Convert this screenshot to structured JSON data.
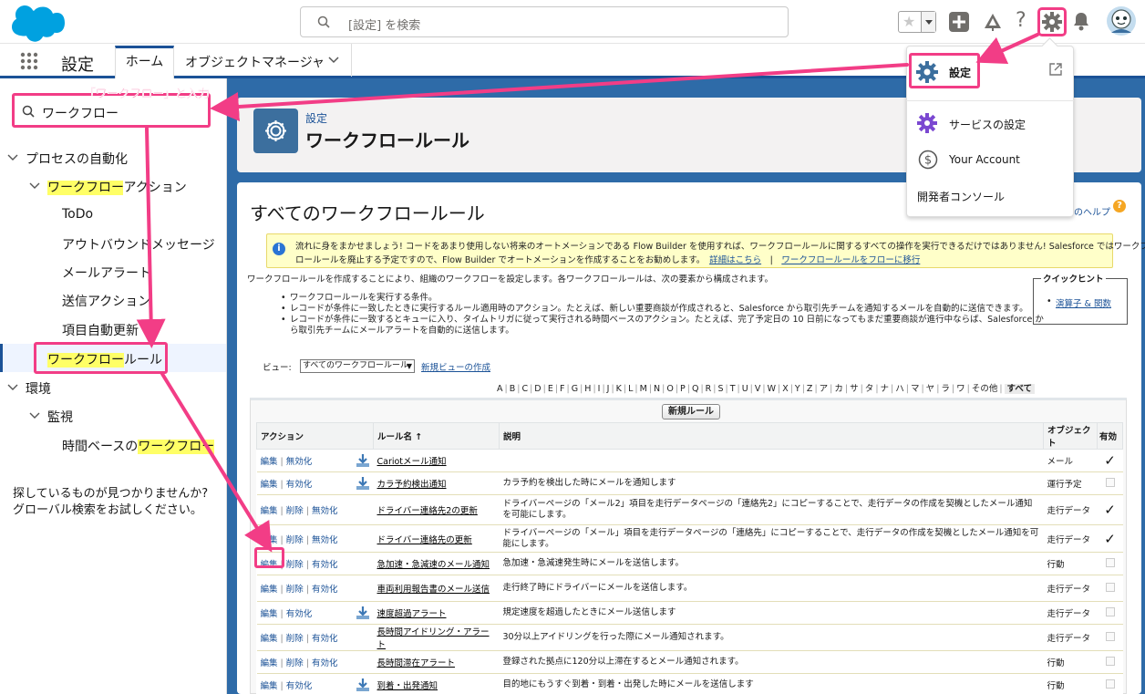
{
  "header": {
    "search_placeholder": "[設定] を検索",
    "colors": {
      "brand": "#00a1e0",
      "accent": "#1b5297",
      "highlight": "#f23d86"
    }
  },
  "nav": {
    "app_title": "設定",
    "tabs": [
      {
        "label": "ホーム"
      },
      {
        "label": "オブジェクトマネージャ"
      }
    ]
  },
  "annotation": {
    "sidebar_label": "「ワークフロー」と入力"
  },
  "sidebar": {
    "search_value": "ワークフロー",
    "process_automation": "プロセスの自動化",
    "workflow_actions_hl": "ワークフロー",
    "workflow_actions_rest": "アクション",
    "items": [
      "ToDo",
      "アウトバウンドメッセージ",
      "メールアラート",
      "送信アクション",
      "項目自動更新"
    ],
    "workflow_rules_hl": "ワークフロー",
    "workflow_rules_rest": "ルール",
    "environment": "環境",
    "monitoring": "監視",
    "time_based_prefix": "時間ベースの",
    "time_based_hl": "ワークフロー",
    "not_found_1": "探しているものが見つかりませんか?",
    "not_found_2": "グローバル検索をお試しください。"
  },
  "page_header": {
    "breadcrumb": "設定",
    "title": "ワークフロールール"
  },
  "main": {
    "title": "すべてのワークフロールール",
    "help_link": "のヘルプ",
    "info_line1": "流れに身をまかせましょう! コードをあまり使用しない将来のオートメーションである Flow Builder を使用すれば、ワークフロールールに関するすべての操作を実行できるだけではありません! Salesforce ではワークフ",
    "info_line2": "ロールールを廃止する予定ですので、Flow Builder でオートメーションを作成することをお勧めします。",
    "info_link1": "詳細はこちら",
    "info_sep": "|",
    "info_link2": "ワークフロールールをフローに移行",
    "description": "ワークフロールールを作成することにより、組織のワークフローを設定します。各ワークフロールールは、次の要素から構成されます。",
    "bullets": [
      "ワークフロールールを実行する条件。",
      "レコードが条件に一致したときに実行するルール適用時のアクション。たとえば、新しい重要商談が作成されると、Salesforce から取引先チームを通知するメールを自動的に送信できます。",
      "レコードが条件に一致するとキューに入り、タイムトリガに従って実行される時間ベースのアクション。たとえば、完了予定日の 10 日前になってもまだ重要商談が進行中ならば、Salesforce か",
      "ら取引先チームにメールアラートを自動的に送信します。"
    ],
    "tips_title": "クイックヒント",
    "tips_link": "演算子 & 関数",
    "view_label": "ビュー:",
    "view_selected": "すべてのワークフロールール",
    "new_view": "新規ビューの作成",
    "alphabet": [
      "A",
      "B",
      "C",
      "D",
      "E",
      "F",
      "G",
      "H",
      "I",
      "J",
      "K",
      "L",
      "M",
      "N",
      "O",
      "P",
      "Q",
      "R",
      "S",
      "T",
      "U",
      "V",
      "W",
      "X",
      "Y",
      "Z",
      "ア",
      "カ",
      "サ",
      "タ",
      "ナ",
      "ハ",
      "マ",
      "ヤ",
      "ラ",
      "ワ",
      "その他",
      "すべて"
    ],
    "new_rule_button": "新規ルール"
  },
  "table": {
    "headers": [
      "アクション",
      "ルール名 ↑",
      "説明",
      "オブジェクト",
      "有効"
    ],
    "rows": [
      {
        "actions": [
          "編集",
          "無効化"
        ],
        "name": "Cariotメール通知",
        "desc": "",
        "object": "メール",
        "active": "✓"
      },
      {
        "actions": [
          "編集",
          "有効化"
        ],
        "name": "カラ予約検出通知",
        "desc": "カラ予約を検出した時にメールを通知します",
        "object": "運行予定",
        "active": ""
      },
      {
        "actions": [
          "編集",
          "削除",
          "無効化"
        ],
        "name": "ドライバー連絡先2の更新",
        "desc": "ドライバーページの「メール2」項目を走行データページの「連絡先2」にコピーすることで、走行データの作成を契機としたメール通知を可能にします。",
        "object": "走行データ",
        "active": "✓"
      },
      {
        "actions": [
          "編集",
          "削除",
          "無効化"
        ],
        "name": "ドライバー連絡先の更新",
        "desc": "ドライバーページの「メール」項目を走行データページの「連絡先」にコピーすることで、走行データの作成を契機としたメール通知を可能にします。",
        "object": "走行データ",
        "active": "✓"
      },
      {
        "actions": [
          "編集",
          "削除",
          "有効化"
        ],
        "name": "急加速・急減速のメール通知",
        "desc": "急加速・急減速発生時にメールを送信します。",
        "object": "行動",
        "active": ""
      },
      {
        "actions": [
          "編集",
          "削除",
          "有効化"
        ],
        "name": "車両利用報告書のメール送信",
        "desc": "走行終了時にドライバーにメールを送信します。",
        "object": "走行データ",
        "active": ""
      },
      {
        "actions": [
          "編集",
          "有効化"
        ],
        "name": "速度超過アラート",
        "desc": "規定速度を超過したときにメール送信します",
        "object": "走行データ",
        "active": ""
      },
      {
        "actions": [
          "編集",
          "削除",
          "有効化"
        ],
        "name": "長時間アイドリング・アラート",
        "desc": "30分以上アイドリングを行った際にメール通知されます。",
        "object": "走行データ",
        "active": ""
      },
      {
        "actions": [
          "編集",
          "削除",
          "有効化"
        ],
        "name": "長時間滞在アラート",
        "desc": "登録された拠点に120分以上滞在するとメール通知されます。",
        "object": "行動",
        "active": ""
      },
      {
        "actions": [
          "編集",
          "有効化"
        ],
        "name": "到着・出発通知",
        "desc": "目的地にもうすぐ到着・到着・出発した時にメールを送信します",
        "object": "行動",
        "active": ""
      }
    ]
  },
  "settings_menu": {
    "setup": "設定",
    "service_setup": "サービスの設定",
    "your_account": "Your Account",
    "dev_console": "開発者コンソール"
  }
}
